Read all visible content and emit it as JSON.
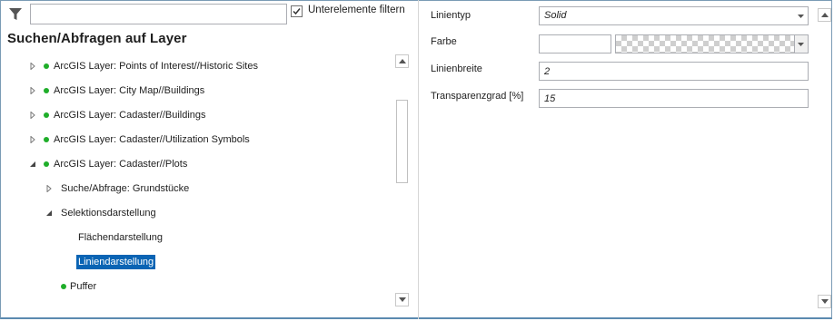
{
  "filter": {
    "icon": "filter-icon",
    "value": "",
    "checkbox_checked": true,
    "checkbox_label": "Unterelemente filtern"
  },
  "panel_title": "Suchen/Abfragen auf Layer",
  "tree": {
    "items": [
      {
        "label": "ArcGIS Layer: Points of Interest//Historic Sites",
        "state": "collapsed",
        "dot": true
      },
      {
        "label": "ArcGIS Layer: City Map//Buildings",
        "state": "collapsed",
        "dot": true
      },
      {
        "label": "ArcGIS Layer: Cadaster//Buildings",
        "state": "collapsed",
        "dot": true
      },
      {
        "label": "ArcGIS Layer: Cadaster//Utilization Symbols",
        "state": "collapsed",
        "dot": true
      },
      {
        "label": "ArcGIS Layer: Cadaster//Plots",
        "state": "expanded",
        "dot": true
      },
      {
        "label": "Suche/Abfrage: Grundstücke",
        "state": "collapsed",
        "dot": false
      },
      {
        "label": "Selektionsdarstellung",
        "state": "expanded",
        "dot": false
      },
      {
        "label": "Flächendarstellung",
        "state": "leaf",
        "dot": false
      },
      {
        "label": "Liniendarstellung",
        "state": "leaf",
        "dot": false,
        "selected": true
      },
      {
        "label": "Puffer",
        "state": "leaf",
        "dot": true
      }
    ]
  },
  "properties": {
    "line_type": {
      "label": "Linientyp",
      "value": "Solid"
    },
    "color": {
      "label": "Farbe",
      "value": ""
    },
    "line_width": {
      "label": "Linienbreite",
      "value": "2"
    },
    "transparency": {
      "label": "Transparenzgrad [%]",
      "value": "15"
    }
  },
  "colors": {
    "selection": "#0a64b4",
    "dot": "#1fae2a",
    "frame": "#7a9bb5"
  }
}
